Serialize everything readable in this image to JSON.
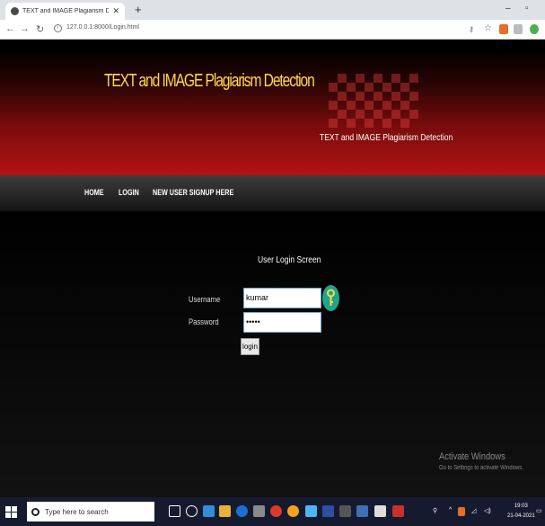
{
  "browser": {
    "tab_title": "TEXT and IMAGE Plagiarism Dete",
    "url": "127.0.0.1:8000/Login.html"
  },
  "header": {
    "title": "TEXT and IMAGE Plagiarism Detection",
    "subtitle": "TEXT and IMAGE Plagiarism Detection"
  },
  "menu": {
    "home": "HOME",
    "login": "LOGIN",
    "signup": "NEW USER SIGNUP HERE"
  },
  "login_form": {
    "screen_title": "User Login Screen",
    "username_label": "Username",
    "username_value": "kumar",
    "password_label": "Password",
    "password_value": "•••••",
    "submit_label": "login"
  },
  "watermark": {
    "line1": "Activate Windows",
    "line2": "Go to Settings to activate Windows."
  },
  "taskbar": {
    "search_placeholder": "Type here to search",
    "time": "19:03",
    "date": "21-04-2021"
  },
  "colors": {
    "header_red": "#b31313",
    "title_yellow": "#ffd84d",
    "key_icon": "#1ea58b"
  }
}
